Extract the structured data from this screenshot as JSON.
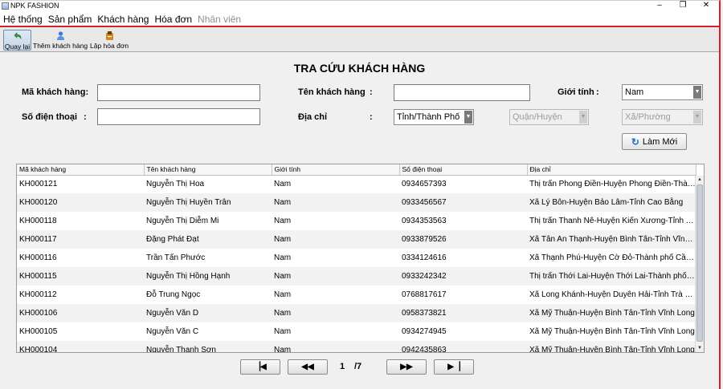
{
  "window": {
    "title": "NPK FASHION",
    "minimize": "–",
    "maximize": "❐",
    "close": "✕"
  },
  "menu": [
    {
      "label": "Hệ thống",
      "enabled": true
    },
    {
      "label": "Sản phẩm",
      "enabled": true
    },
    {
      "label": "Khách hàng",
      "enabled": true
    },
    {
      "label": "Hóa đơn",
      "enabled": true
    },
    {
      "label": "Nhân viên",
      "enabled": false
    }
  ],
  "toolbar": {
    "back_label": "Quay lại",
    "add_customer_label": "Thêm khách hàng",
    "create_invoice_label": "Lập hóa đơn"
  },
  "page_title": "TRA CỨU KHÁCH HÀNG",
  "form": {
    "customer_id_label": "Mã khách hàng:",
    "customer_name_label": "Tên khách hàng",
    "gender_label": "Giới tính",
    "phone_label": "Số điện thoại",
    "address_label": "Địa chỉ",
    "colon": ":",
    "customer_id_value": "",
    "customer_name_value": "",
    "phone_value": "",
    "gender_selected": "Nam",
    "province_selected": "Tỉnh/Thành Phố",
    "district_selected": "Quận/Huyện",
    "ward_selected": "Xã/Phường",
    "refresh_label": "Làm Mới"
  },
  "table": {
    "columns": [
      "Mã khách hàng",
      "Tên khách hàng",
      "Giới tính",
      "Số điện thoại",
      "Địa chỉ"
    ],
    "rows": [
      [
        "KH000121",
        "Nguyễn Thị Hoa",
        "Nam",
        "0934657393",
        "Thị trấn Phong Điền-Huyện Phong Điền-Thàn..."
      ],
      [
        "KH000120",
        "Nguyễn Thị Huyền Trân",
        "Nam",
        "0933456567",
        "Xã Lý Bôn-Huyện Bảo Lâm-Tỉnh Cao Bằng"
      ],
      [
        "KH000118",
        "Nguyễn Thị Diễm Mi",
        "Nam",
        "0934353563",
        "Thị trấn Thanh Nê-Huyện Kiến Xương-Tỉnh Th..."
      ],
      [
        "KH000117",
        "Đặng Phát Đạt",
        "Nam",
        "0933879526",
        "Xã Tân An Thạnh-Huyện Bình Tân-Tỉnh Vĩnh L..."
      ],
      [
        "KH000116",
        "Trần Tấn Phước",
        "Nam",
        "0334124616",
        "Xã Thạnh Phú-Huyện Cờ Đỏ-Thành phố Cần ..."
      ],
      [
        "KH000115",
        "Nguyễn Thị Hồng Hạnh",
        "Nam",
        "0933242342",
        "Thị trấn Thới Lai-Huyện Thới Lai-Thành phố C..."
      ],
      [
        "KH000112",
        "Đỗ Trung Ngọc",
        "Nam",
        "0768817617",
        "Xã Long Khánh-Huyện Duyên Hải-Tỉnh Trà Vinh"
      ],
      [
        "KH000106",
        "Nguyễn Văn D",
        "Nam",
        "0958373821",
        "Xã Mỹ Thuận-Huyện Bình Tân-Tỉnh Vĩnh Long"
      ],
      [
        "KH000105",
        "Nguyễn Văn C",
        "Nam",
        "0934274945",
        "Xã Mỹ Thuận-Huyện Bình Tân-Tỉnh Vĩnh Long"
      ],
      [
        "KH000104",
        "Nguyễn Thanh Sơn",
        "Nam",
        "0942435863",
        "Xã Mỹ Thuận-Huyện Bình Tân-Tỉnh Vĩnh Long"
      ]
    ]
  },
  "pagination": {
    "current": "1",
    "total": "/7",
    "first_icon": "▕◀",
    "prev_icon": "◀◀",
    "next_icon": "▶▶",
    "last_icon": "▶▕"
  },
  "colors": {
    "accent_border": "#d31f2a",
    "refresh_icon": "#1f6fc5"
  }
}
